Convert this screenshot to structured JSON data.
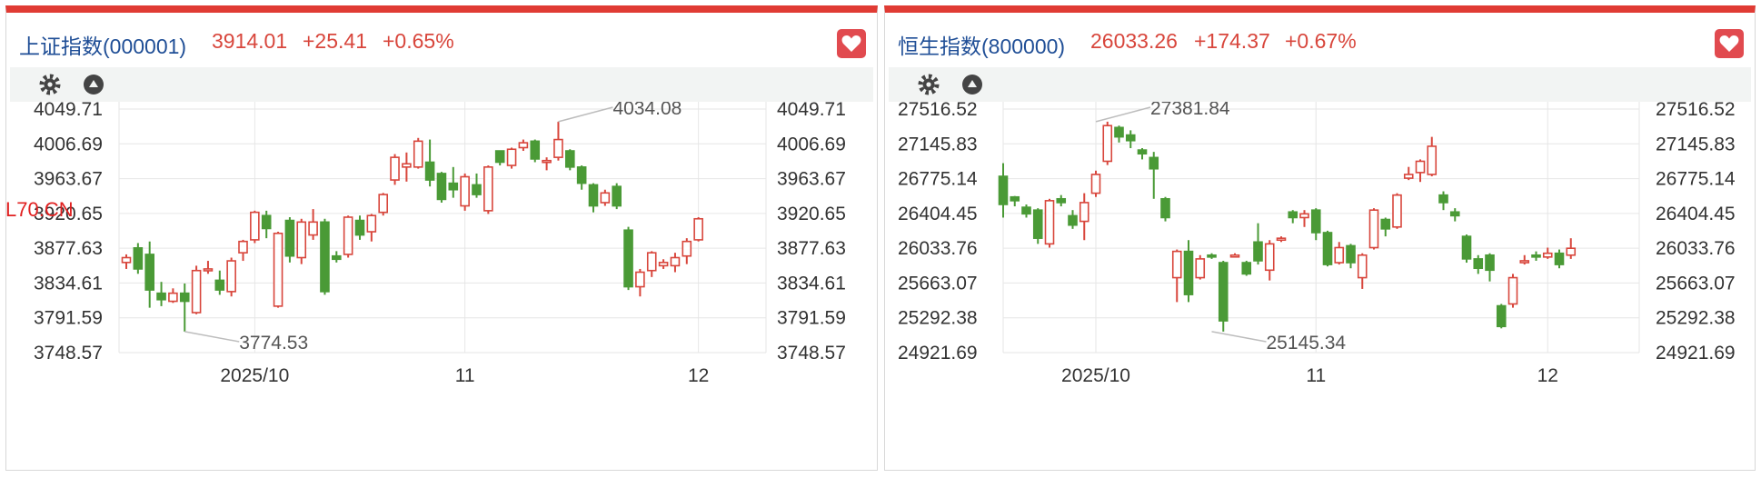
{
  "colors": {
    "up": "#d8463c",
    "down": "#4a9a36",
    "accent": "#e03b34",
    "title_blue": "#1f4e96"
  },
  "icons": {
    "favorite": "heart-icon",
    "settings": "gear-icon",
    "collapse": "triangle-up-icon"
  },
  "stray_label": "L70.CN",
  "panels": [
    {
      "title": "上证指数(000001)",
      "price": "3914.01",
      "change": "+25.41",
      "change_pct": "+0.65%",
      "chart_data": {
        "type": "candlestick",
        "y_ticks": [
          "4049.71",
          "4006.69",
          "3963.67",
          "3920.65",
          "3877.63",
          "3834.61",
          "3791.59",
          "3748.57"
        ],
        "y_range": [
          3748.57,
          4049.71
        ],
        "x_labels": [
          {
            "label": "2025/10",
            "index": 11
          },
          {
            "label": "11",
            "index": 29
          },
          {
            "label": "12",
            "index": 49
          }
        ],
        "annotations": [
          {
            "label": "4034.08",
            "index": 37,
            "value": 4034.08
          },
          {
            "label": "3774.53",
            "index": 5,
            "value": 3774.53
          }
        ],
        "candles": [
          [
            3860,
            3866,
            3852,
            3870
          ],
          [
            3878,
            3852,
            3846,
            3884
          ],
          [
            3870,
            3826,
            3804,
            3886
          ],
          [
            3822,
            3814,
            3806,
            3836
          ],
          [
            3812,
            3822,
            3810,
            3828
          ],
          [
            3822,
            3812,
            3774.53,
            3834
          ],
          [
            3798,
            3850,
            3796,
            3856
          ],
          [
            3850,
            3852,
            3846,
            3862
          ],
          [
            3838,
            3826,
            3820,
            3850
          ],
          [
            3824,
            3862,
            3818,
            3866
          ],
          [
            3872,
            3886,
            3862,
            3888
          ],
          [
            3888,
            3922,
            3884,
            3924
          ],
          [
            3918,
            3902,
            3890,
            3924
          ],
          [
            3806,
            3896,
            3804,
            3898
          ],
          [
            3912,
            3868,
            3860,
            3916
          ],
          [
            3866,
            3910,
            3858,
            3914
          ],
          [
            3894,
            3910,
            3888,
            3926
          ],
          [
            3910,
            3824,
            3820,
            3914
          ],
          [
            3868,
            3864,
            3860,
            3874
          ],
          [
            3870,
            3916,
            3866,
            3918
          ],
          [
            3912,
            3894,
            3888,
            3918
          ],
          [
            3898,
            3918,
            3886,
            3920
          ],
          [
            3922,
            3944,
            3918,
            3946
          ],
          [
            3962,
            3990,
            3956,
            3994
          ],
          [
            3978,
            3982,
            3960,
            3996
          ],
          [
            3978,
            4010,
            3976,
            4014
          ],
          [
            3984,
            3962,
            3954,
            4012
          ],
          [
            3970,
            3938,
            3934,
            3972
          ],
          [
            3958,
            3950,
            3940,
            3978
          ],
          [
            3930,
            3966,
            3924,
            3970
          ],
          [
            3956,
            3944,
            3940,
            3970
          ],
          [
            3924,
            3978,
            3920,
            3980
          ],
          [
            3998,
            3984,
            3980,
            3998
          ],
          [
            3980,
            4000,
            3976,
            4002
          ],
          [
            4002,
            4008,
            3998,
            4012
          ],
          [
            4010,
            3988,
            3984,
            4012
          ],
          [
            3986,
            3986,
            3974,
            3990
          ],
          [
            3990,
            4012,
            3986,
            4034.08
          ],
          [
            3998,
            3978,
            3974,
            4000
          ],
          [
            3978,
            3958,
            3950,
            3980
          ],
          [
            3956,
            3930,
            3922,
            3958
          ],
          [
            3934,
            3946,
            3930,
            3950
          ],
          [
            3954,
            3930,
            3926,
            3958
          ],
          [
            3900,
            3830,
            3826,
            3904
          ],
          [
            3830,
            3848,
            3818,
            3852
          ],
          [
            3850,
            3872,
            3842,
            3874
          ],
          [
            3856,
            3860,
            3852,
            3864
          ],
          [
            3856,
            3866,
            3848,
            3872
          ],
          [
            3868,
            3886,
            3858,
            3890
          ],
          [
            3888,
            3914.01,
            3886,
            3916
          ]
        ]
      }
    },
    {
      "title": "恒生指数(800000)",
      "price": "26033.26",
      "change": "+174.37",
      "change_pct": "+0.67%",
      "chart_data": {
        "type": "candlestick",
        "y_ticks": [
          "27516.52",
          "27145.83",
          "26775.14",
          "26404.45",
          "26033.76",
          "25663.07",
          "25292.38",
          "24921.69"
        ],
        "y_range": [
          24921.69,
          27516.52
        ],
        "x_labels": [
          {
            "label": "2025/10",
            "index": 8
          },
          {
            "label": "11",
            "index": 27
          },
          {
            "label": "12",
            "index": 47
          }
        ],
        "annotations": [
          {
            "label": "27381.84",
            "index": 8,
            "value": 27381.84
          },
          {
            "label": "25145.34",
            "index": 18,
            "value": 25145.34
          }
        ],
        "candles": [
          [
            26800,
            26500,
            26360,
            26940
          ],
          [
            26580,
            26540,
            26480,
            26590
          ],
          [
            26470,
            26400,
            26360,
            26500
          ],
          [
            26440,
            26140,
            26080,
            26460
          ],
          [
            26080,
            26540,
            26040,
            26560
          ],
          [
            26560,
            26520,
            26480,
            26600
          ],
          [
            26380,
            26280,
            26240,
            26440
          ],
          [
            26320,
            26520,
            26120,
            26620
          ],
          [
            26620,
            26820,
            26580,
            26860
          ],
          [
            26960,
            27340,
            26920,
            27381.84
          ],
          [
            27320,
            27220,
            27160,
            27340
          ],
          [
            27240,
            27180,
            27100,
            27290
          ],
          [
            27080,
            27040,
            26980,
            27100
          ],
          [
            27000,
            26880,
            26560,
            27060
          ],
          [
            26560,
            26360,
            26320,
            26580
          ],
          [
            25720,
            26000,
            25460,
            26020
          ],
          [
            26000,
            25540,
            25460,
            26120
          ],
          [
            25720,
            25920,
            25700,
            25960
          ],
          [
            25960,
            25940,
            25920,
            25980
          ],
          [
            25880,
            25260,
            25145.34,
            25900
          ],
          [
            25960,
            25960,
            25960,
            25980
          ],
          [
            25880,
            25760,
            25740,
            25900
          ],
          [
            26100,
            25900,
            25860,
            26300
          ],
          [
            25800,
            26080,
            25690,
            26120
          ],
          [
            26120,
            26140,
            26100,
            26160
          ],
          [
            26420,
            26360,
            26300,
            26440
          ],
          [
            26360,
            26400,
            26260,
            26440
          ],
          [
            26440,
            26200,
            26120,
            26460
          ],
          [
            26200,
            25860,
            25840,
            26220
          ],
          [
            25880,
            26040,
            25860,
            26100
          ],
          [
            26060,
            25880,
            25820,
            26080
          ],
          [
            25720,
            25960,
            25600,
            25980
          ],
          [
            26040,
            26440,
            26020,
            26460
          ],
          [
            26340,
            26240,
            26160,
            26360
          ],
          [
            26260,
            26600,
            26240,
            26620
          ],
          [
            26780,
            26820,
            26760,
            26900
          ],
          [
            26840,
            26960,
            26740,
            26980
          ],
          [
            26820,
            27120,
            26800,
            27220
          ],
          [
            26600,
            26520,
            26440,
            26640
          ],
          [
            26420,
            26380,
            26320,
            26460
          ],
          [
            26160,
            25920,
            25880,
            26180
          ],
          [
            25920,
            25820,
            25760,
            25960
          ],
          [
            25960,
            25800,
            25680,
            25980
          ],
          [
            25420,
            25200,
            25180,
            25440
          ],
          [
            25440,
            25720,
            25400,
            25760
          ],
          [
            25880,
            25900,
            25860,
            25960
          ],
          [
            25960,
            25940,
            25900,
            26000
          ],
          [
            25940,
            25980,
            25920,
            26040
          ],
          [
            25980,
            25860,
            25820,
            26020
          ],
          [
            25960,
            26033.26,
            25920,
            26140
          ]
        ]
      }
    }
  ]
}
